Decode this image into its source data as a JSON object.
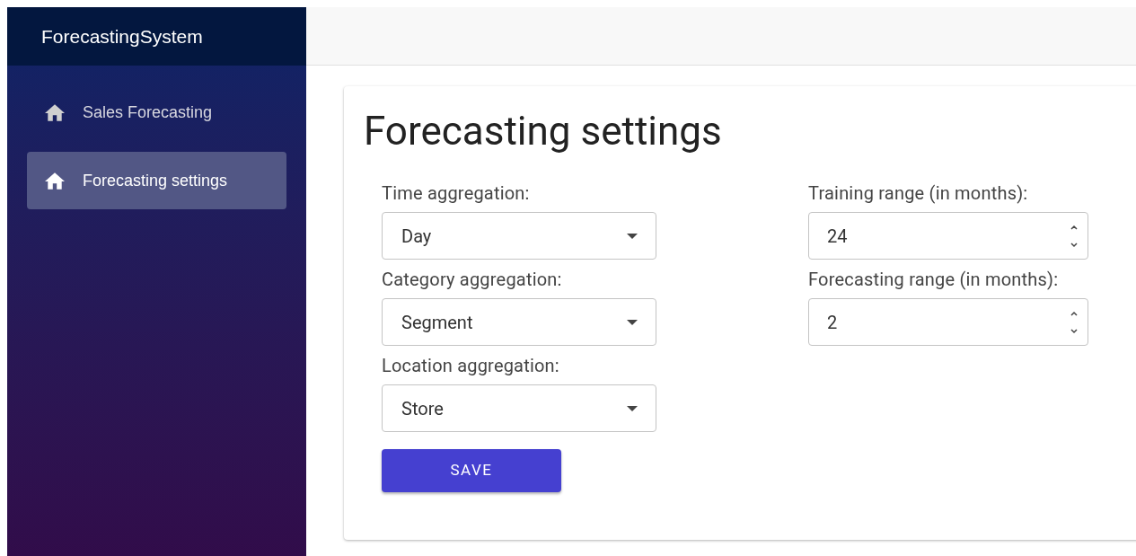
{
  "app": {
    "title": "ForecastingSystem"
  },
  "sidebar": {
    "items": [
      {
        "label": "Sales Forecasting",
        "selected": false
      },
      {
        "label": "Forecasting settings",
        "selected": true
      }
    ]
  },
  "page": {
    "title": "Forecasting settings"
  },
  "form": {
    "left_fields": [
      {
        "kind": "select",
        "label": "Time aggregation:",
        "value": "Day"
      },
      {
        "kind": "select",
        "label": "Category aggregation:",
        "value": "Segment"
      },
      {
        "kind": "select",
        "label": "Location aggregation:",
        "value": "Store"
      }
    ],
    "right_fields": [
      {
        "kind": "number",
        "label": "Training range (in months):",
        "value": "24"
      },
      {
        "kind": "number",
        "label": "Forecasting range (in months):",
        "value": "2"
      }
    ],
    "save_button": "SAVE"
  }
}
